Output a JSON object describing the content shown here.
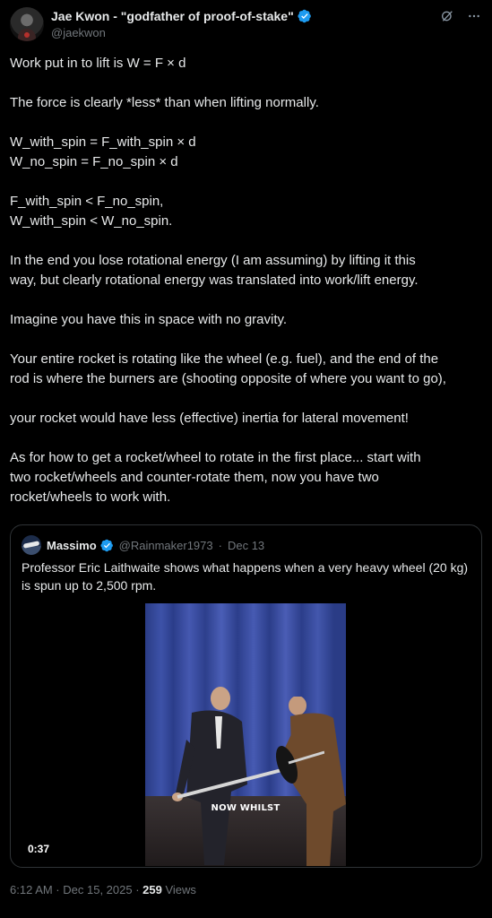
{
  "author": {
    "display_name": "Jae Kwon - \"godfather of proof-of-stake\"",
    "handle": "@jaekwon",
    "verified_icon": "verified-badge-icon"
  },
  "header_icons": [
    "grok-icon",
    "more-icon"
  ],
  "tweet_lines": [
    "Work put in to lift is W = F × d",
    "",
    "The force is clearly *less* than when lifting normally.",
    "",
    "W_with_spin = F_with_spin × d",
    "W_no_spin = F_no_spin × d",
    "",
    "F_with_spin < F_no_spin,",
    "W_with_spin < W_no_spin.",
    "",
    "In the end you lose rotational energy (I am assuming) by lifting it this",
    "way, but clearly rotational energy was translated into work/lift energy.",
    "",
    "Imagine you have this in space with no gravity.",
    "",
    "Your entire rocket is rotating like the wheel (e.g. fuel), and the end of the",
    "rod is where the burners are (shooting opposite of where you want to go),",
    "",
    "your rocket would have less (effective) inertia for lateral movement!",
    "",
    "As for how to get a rocket/wheel to rotate in the first place... start with",
    "two rocket/wheels and counter-rotate them, now you have two",
    "rocket/wheels to work with."
  ],
  "quote": {
    "display_name": "Massimo",
    "handle": "@Rainmaker1973",
    "separator": "·",
    "date": "Dec 13",
    "text": "Professor Eric Laithwaite shows what happens when a very heavy wheel (20 kg) is spun up to 2,500 rpm.",
    "video_caption": "NOW WHILST",
    "video_duration": "0:37"
  },
  "meta": {
    "time_date": "6:12 AM · Dec 15, 2025 · ",
    "views_count": "259",
    "views_label": " Views"
  },
  "colors": {
    "background": "#000000",
    "text": "#e7e9ea",
    "muted": "#71767b",
    "border": "#2f3336",
    "verified": "#1d9bf0"
  }
}
